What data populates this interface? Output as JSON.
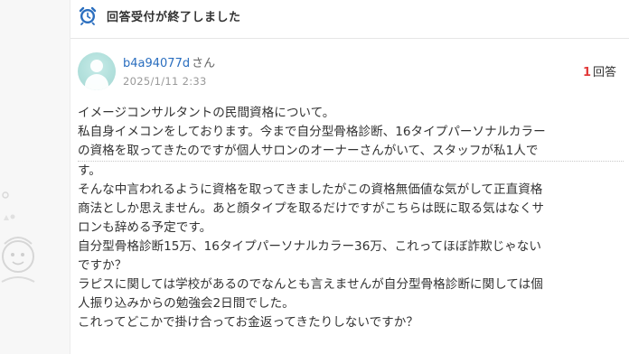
{
  "notice": {
    "icon": "alarm-clock-icon",
    "text": "回答受付が終了しました",
    "icon_color": "#2a6ebf"
  },
  "question": {
    "avatar_icon": "user-avatar-icon",
    "avatar_color": "#b2e0dc",
    "username": "b4a94077d",
    "honorific": "さん",
    "date": "2025/1/11 2:33",
    "answer_count": "1",
    "answer_label": "回答",
    "lines": [
      "イメージコンサルタントの民間資格について。",
      "私自身イメコンをしております。今まで自分型骨格診断、16タイプパーソナルカラー",
      "の資格を取ってきたのですが個人サロンのオーナーさんがいて、スタッフが私1人で",
      "す。",
      "そんな中言われるように資格を取ってきましたがこの資格無価値な気がして正直資格",
      "商法としか思えません。あと顔タイプを取るだけですがこちらは既に取る気はなくサ",
      "ロンも辞める予定です。",
      "自分型骨格診断15万、16タイプパーソナルカラー36万、これってほぼ詐欺じゃない",
      "ですか？",
      "ラピスに関しては学校があるのでなんとも言えませんが自分型骨格診断に関しては個",
      "人振り込みからの勉強会2日間でした。",
      "これってどこかで掛け合ってお金返ってきたりしないですか？"
    ]
  }
}
